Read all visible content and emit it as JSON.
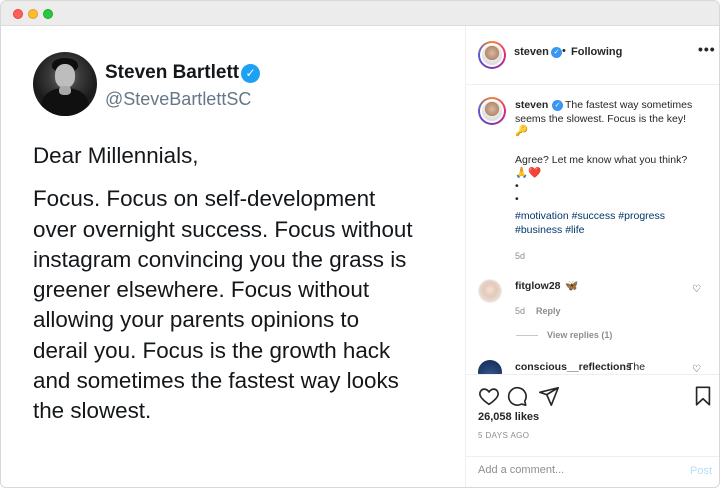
{
  "tweet": {
    "name": "Steven Bartlett",
    "handle": "@SteveBartlettSC",
    "greeting": "Dear Millennials,",
    "lines": [
      "Focus. Focus on self-development",
      "over overnight success. Focus without",
      "instagram convincing you the grass is",
      "greener elsewhere. Focus without",
      "allowing your parents opinions to",
      "derail you. Focus is the growth hack",
      "and sometimes the fastest way looks",
      "the slowest."
    ]
  },
  "header": {
    "username": "steven",
    "separator": "•",
    "follow_status": "Following",
    "more": "•••"
  },
  "caption": {
    "username": "steven",
    "text_line1": "The fastest way sometimes",
    "text_line2": "seems the slowest. Focus is the key!",
    "emoji1": "🔑",
    "text_line3": "Agree? Let me know what you think?",
    "emoji2": "🙏❤️",
    "dot1": "•",
    "dot2": "•",
    "hashtags_line1": "#motivation #success #progress",
    "hashtags_line2": "#business #life",
    "time": "5d"
  },
  "comments": [
    {
      "username": "fitglow28",
      "emoji": "🦋",
      "time": "5d",
      "reply_label": "Reply",
      "view_replies": "View replies (1)"
    },
    {
      "username": "conscious__reflections",
      "text": "The"
    }
  ],
  "footer": {
    "likes": "26,058 likes",
    "date": "5 DAYS AGO",
    "comment_placeholder": "Add a comment...",
    "post_label": "Post"
  }
}
